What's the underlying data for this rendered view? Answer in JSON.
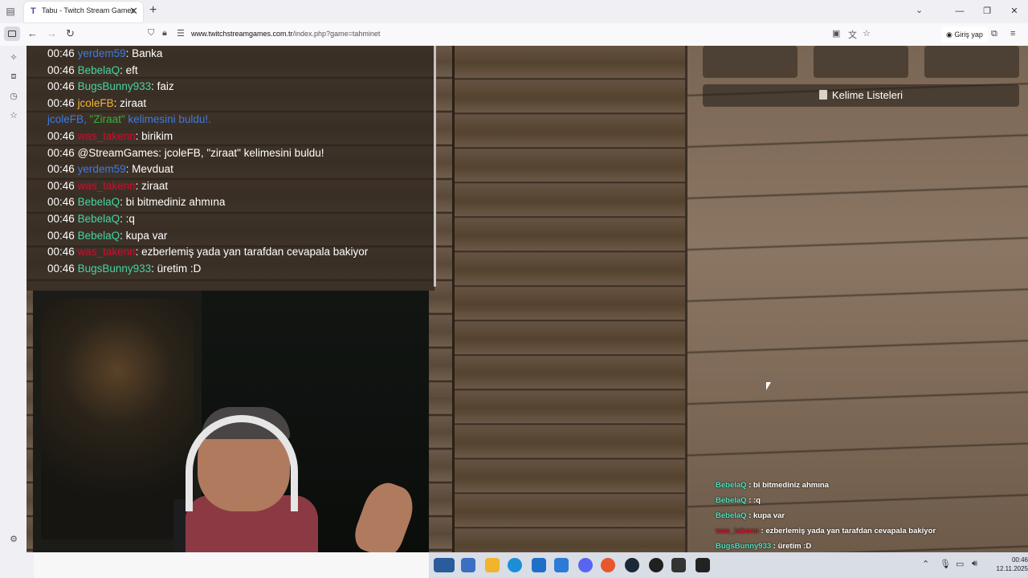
{
  "browser": {
    "tab_title": "Tabu - Twitch Stream Games",
    "tab_icon": "T",
    "new_tab": "+",
    "close_tab": "✕",
    "url_domain": "www.twitchstreamgames.com.tr",
    "url_path": "/index.php?game=tahminet",
    "signin_label": "Giriş yap"
  },
  "chat": {
    "lines": [
      {
        "time": "00:46",
        "user": "yerdem59",
        "color": "blue",
        "msg": ": Banka"
      },
      {
        "time": "00:46",
        "user": "BebelaQ",
        "color": "green",
        "msg": ": eft"
      },
      {
        "time": "00:46",
        "user": "BugsBunny933",
        "color": "green",
        "msg": ": faiz"
      },
      {
        "time": "00:46",
        "user": "jcoleFB",
        "color": "orange",
        "msg": ": ziraat"
      },
      {
        "time": "",
        "user": "jcoleFB, ",
        "color": "blue",
        "msg": "",
        "system": true,
        "quoted": "\"Ziraat\"",
        "suffix": " kelimesini buldu!."
      },
      {
        "time": "00:46",
        "user": "was_takenn",
        "color": "red",
        "msg": ": birikim"
      },
      {
        "time": "00:46",
        "user": "@StreamGames",
        "color": "white",
        "msg": ": jcoleFB, \"ziraat\" kelimesini buldu!"
      },
      {
        "time": "00:46",
        "user": "yerdem59",
        "color": "blue",
        "msg": ": Mevduat"
      },
      {
        "time": "00:46",
        "user": "was_takenn",
        "color": "red",
        "msg": ": ziraat"
      },
      {
        "time": "00:46",
        "user": "BebelaQ",
        "color": "green",
        "msg": ": bi bitmediniz ahmına"
      },
      {
        "time": "00:46",
        "user": "BebelaQ",
        "color": "green",
        "msg": ": :q"
      },
      {
        "time": "00:46",
        "user": "BebelaQ",
        "color": "green",
        "msg": ": kupa var"
      },
      {
        "time": "00:46",
        "user": "was_takenn",
        "color": "red",
        "msg": ": ezberlemiş yada yan tarafdan cevapala bakiyor"
      },
      {
        "time": "00:46",
        "user": "BugsBunny933",
        "color": "green",
        "msg": ": üretim :D"
      }
    ]
  },
  "game": {
    "word_lists_label": "Kelime Listeleri"
  },
  "overlay_chat": [
    {
      "user": "BebelaQ",
      "color": "teal",
      "msg": " : bi bitmediniz ahmına"
    },
    {
      "user": "BebelaQ",
      "color": "teal",
      "msg": " : :q"
    },
    {
      "user": "BebelaQ",
      "color": "teal",
      "msg": " : kupa var"
    },
    {
      "user": "was_takenn",
      "color": "red",
      "msg": " : ezberlemiş yada yan tarafdan cevapala bakiyor"
    },
    {
      "user": "BugsBunny933",
      "color": "teal",
      "msg": " : üretim :D"
    }
  ],
  "taskbar": {
    "clock_time": "00:46",
    "clock_date": "12.11.2025"
  }
}
